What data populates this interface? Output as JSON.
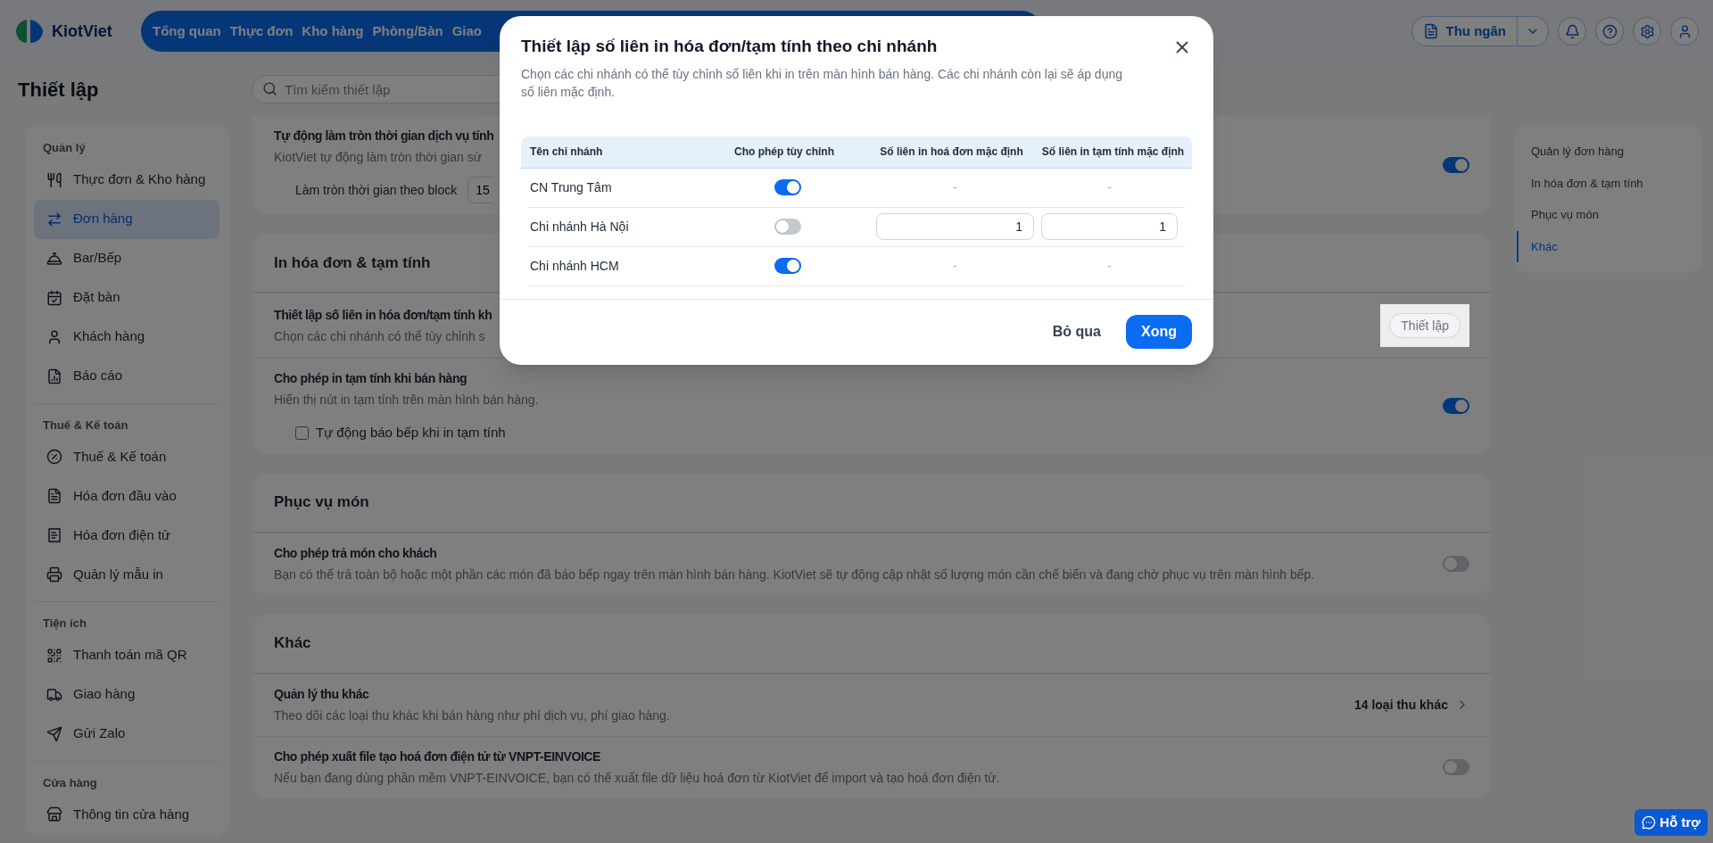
{
  "header": {
    "logo": "KiotViet",
    "nav": [
      {
        "label": "Tổng quan"
      },
      {
        "label": "Thực đơn"
      },
      {
        "label": "Kho hàng"
      },
      {
        "label": "Phòng/Bàn"
      },
      {
        "label": "Giao"
      }
    ],
    "cashier": "Thu ngân"
  },
  "page": {
    "title": "Thiết lập",
    "search": {
      "placeholder": "Tìm kiếm thiết lập"
    }
  },
  "sidebar": {
    "groups": [
      {
        "title": "Quản lý",
        "items": [
          {
            "label": "Thực đơn & Kho hàng",
            "selected": false
          },
          {
            "label": "Đơn hàng",
            "selected": true
          },
          {
            "label": "Bar/Bếp",
            "selected": false
          },
          {
            "label": "Đặt bàn",
            "selected": false
          },
          {
            "label": "Khách hàng",
            "selected": false
          },
          {
            "label": "Báo cáo",
            "selected": false
          }
        ]
      },
      {
        "title": "Thuế & Kế toán",
        "items": [
          {
            "label": "Thuế & Kế toán",
            "selected": false
          },
          {
            "label": "Hóa đơn đầu vào",
            "selected": false
          },
          {
            "label": "Hóa đơn điện tử",
            "selected": false
          },
          {
            "label": "Quản lý mẫu in",
            "selected": false
          }
        ]
      },
      {
        "title": "Tiện ích",
        "items": [
          {
            "label": "Thanh toán mã QR",
            "selected": false
          },
          {
            "label": "Giao hàng",
            "selected": false
          },
          {
            "label": "Gửi Zalo",
            "selected": false
          }
        ]
      },
      {
        "title": "Cửa hàng",
        "items": [
          {
            "label": "Thông tin cửa hàng",
            "selected": false
          }
        ]
      }
    ]
  },
  "sections": [
    {
      "rows": [
        {
          "kind": "toggle",
          "title": "Tự động làm tròn thời gian dịch vụ tính",
          "description": "KiotViet tự động làm tròn thời gian sử",
          "on": true,
          "option": {
            "kind": "select",
            "label": "Làm tròn thời gian theo block",
            "value": "15"
          }
        }
      ]
    },
    {
      "title": "In hóa đơn & tạm tính",
      "rows": [
        {
          "kind": "button",
          "title": "Thiết lập số liên in hóa đơn/tạm tính kh",
          "description": "Chọn các chi nhánh có thể tùy chỉnh s",
          "action": "Thiết lập"
        },
        {
          "kind": "toggle",
          "title": "Cho phép in tạm tính khi bán hàng",
          "description": "Hiển thị nút in tạm tính trên màn hình bán hàng.",
          "on": true,
          "option": {
            "kind": "checkbox",
            "label": "Tự động báo bếp khi in tạm tính",
            "checked": false
          }
        }
      ]
    },
    {
      "title": "Phục vụ món",
      "rows": [
        {
          "kind": "toggle",
          "title": "Cho phép trả món cho khách",
          "description": "Bạn có thể trả toàn bộ hoặc một phần các món đã báo bếp ngay trên màn hình bán hàng. KiotViet sẽ tự động cập nhật số lượng món cần chế biến và đang chờ phục vụ trên màn hình bếp.",
          "on": false
        }
      ]
    },
    {
      "title": "Khác",
      "rows": [
        {
          "kind": "link",
          "title": "Quản lý thu khác",
          "description": "Theo dõi các loại thu khác khi bán hàng như phí dịch vụ, phí giao hàng.",
          "value": "14 loại thu khác"
        },
        {
          "kind": "toggle",
          "title": "Cho phép xuất file tạo hoá đơn điện tử từ VNPT-EINVOICE",
          "description": "Nếu bạn đang dùng phần mềm VNPT-EINVOICE, bạn có thể xuất file dữ liệu hoá đơn từ KiotViet để import và tạo hoá đơn điện tử.",
          "on": false
        }
      ]
    }
  ],
  "anchors": [
    {
      "label": "Quản lý đơn hàng",
      "selected": false
    },
    {
      "label": "In hóa đơn & tạm tính",
      "selected": false
    },
    {
      "label": "Phục vụ món",
      "selected": false
    },
    {
      "label": "Khác",
      "selected": true
    }
  ],
  "modal": {
    "title": "Thiết lập số liên in hóa đơn/tạm tính theo chi nhánh",
    "description": "Chọn các chi nhánh có thể tùy chỉnh số liên khi in trên màn hình bán hàng. Các chi nhánh còn lại sẽ áp dụng số liên mặc định.",
    "table": {
      "columns": [
        "Tên chi nhánh",
        "Cho phép tùy chỉnh",
        "Số liên in hoá đơn mặc định",
        "Số liên in tạm tính mặc định"
      ],
      "rows": [
        {
          "cells": [
            {
              "kind": "text",
              "text": "CN Trung Tâm"
            },
            {
              "kind": "toggle",
              "on": true
            },
            {
              "kind": "dash",
              "text": "-"
            },
            {
              "kind": "dash",
              "text": "-"
            }
          ]
        },
        {
          "cells": [
            {
              "kind": "text",
              "text": "Chi nhánh Hà Nội"
            },
            {
              "kind": "toggle",
              "on": false
            },
            {
              "kind": "input",
              "text": "1"
            },
            {
              "kind": "input",
              "text": "1"
            }
          ]
        },
        {
          "cells": [
            {
              "kind": "text",
              "text": "Chi nhánh HCM"
            },
            {
              "kind": "toggle",
              "on": true
            },
            {
              "kind": "dash",
              "text": "-"
            },
            {
              "kind": "dash",
              "text": "-"
            }
          ]
        }
      ]
    },
    "buttons": {
      "cancel": "Bỏ qua",
      "confirm": "Xong"
    }
  },
  "help_button": "Hỗ trợ"
}
